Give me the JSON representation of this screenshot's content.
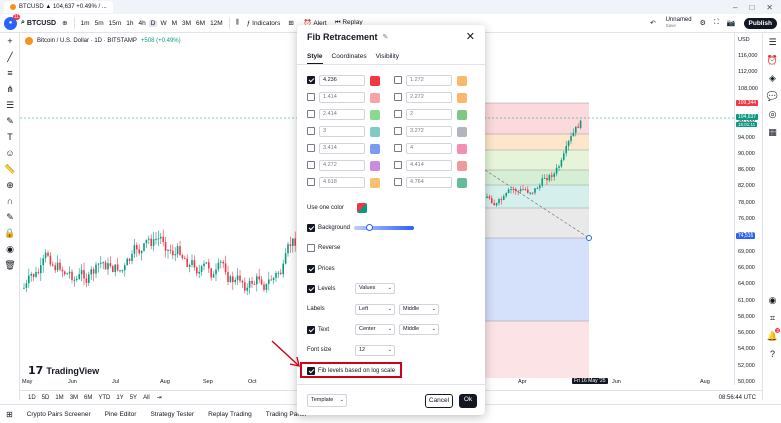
{
  "browser": {
    "tab_title": "BTCUSD ▲ 104,637 +0.49% / ..."
  },
  "toolbar": {
    "avatar_badge": "11",
    "symbol": "BTCUSD",
    "intervals": [
      "1m",
      "5m",
      "15m",
      "1h",
      "4h",
      "D",
      "W",
      "M",
      "3M",
      "6M",
      "12M"
    ],
    "active_interval": "D",
    "indicators_label": "Indicators",
    "alert_label": "Alert",
    "replay_label": "Replay",
    "layout_name": "Unnamed",
    "layout_sub": "Save",
    "publish_label": "Publish"
  },
  "legend": {
    "symbol_desc": "Bitcoin / U.S. Dollar · 1D · BITSTAMP",
    "change": "+508 (+0.49%)"
  },
  "brand": {
    "name": "TradingView"
  },
  "price_axis": {
    "currency": "USD",
    "labels": [
      "116,000",
      "112,000",
      "108,000",
      "104,000",
      "98,000",
      "94,000",
      "90,000",
      "86,000",
      "82,000",
      "78,000",
      "76,000",
      "72,000",
      "69,000",
      "66,000",
      "64,000",
      "61,000",
      "58,000",
      "56,000",
      "54,000",
      "52,000",
      "50,000"
    ],
    "tag_top": "109,344",
    "tag_price": "104,637",
    "tag_time": "15:01:11",
    "tag_low": "74,516"
  },
  "time_axis": {
    "labels": [
      "May",
      "Jun",
      "Jul",
      "Aug",
      "Sep",
      "Oct",
      "Apr",
      "Jun",
      "Aug"
    ],
    "cursor_date": "Fri 16 May '25"
  },
  "range_bar": {
    "ranges": [
      "1D",
      "5D",
      "1M",
      "3M",
      "6M",
      "YTD",
      "1Y",
      "5Y",
      "All"
    ],
    "clock": "08:56:44 UTC"
  },
  "bottom_bar": {
    "items": [
      "Crypto Pairs Screener",
      "Pine Editor",
      "Strategy Tester",
      "Replay Trading",
      "Trading Panel"
    ]
  },
  "right_panel": {
    "notif_badge": "2"
  },
  "dialog": {
    "title": "Fib Retracement",
    "tabs": [
      "Style",
      "Coordinates",
      "Visibility"
    ],
    "active_tab": "Style",
    "levels_left": [
      {
        "value": "4.236",
        "checked": true,
        "color": "#f23645"
      },
      {
        "value": "1.414",
        "checked": false,
        "color": "#f7a1a9"
      },
      {
        "value": "2.414",
        "checked": false,
        "color": "#89d98f"
      },
      {
        "value": "3",
        "checked": false,
        "color": "#80cbc4"
      },
      {
        "value": "3.414",
        "checked": false,
        "color": "#7b9af2"
      },
      {
        "value": "4.272",
        "checked": false,
        "color": "#c98de0"
      },
      {
        "value": "4.618",
        "checked": false,
        "color": "#f9c074"
      }
    ],
    "levels_right": [
      {
        "value": "1.272",
        "checked": false,
        "color": "#f9b86b"
      },
      {
        "value": "2.272",
        "checked": false,
        "color": "#f9b86b"
      },
      {
        "value": "2",
        "checked": false,
        "color": "#81c784"
      },
      {
        "value": "3.272",
        "checked": false,
        "color": "#b2b5be"
      },
      {
        "value": "4",
        "checked": false,
        "color": "#f48fb1"
      },
      {
        "value": "4.414",
        "checked": false,
        "color": "#ef9a9a"
      },
      {
        "value": "4.764",
        "checked": false,
        "color": "#66bb9a"
      }
    ],
    "use_one_color": "Use one color",
    "background": "Background",
    "reverse": "Reverse",
    "prices": "Prices",
    "levels": "Levels",
    "levels_value": "Values",
    "labels": "Labels",
    "labels_h": "Left",
    "labels_v": "Middle",
    "text": "Text",
    "text_h": "Center",
    "text_v": "Middle",
    "font_size": "Font size",
    "font_size_value": "12",
    "log_scale": "Fib levels based on log scale",
    "template": "Template",
    "cancel": "Cancel",
    "ok": "Ok"
  }
}
